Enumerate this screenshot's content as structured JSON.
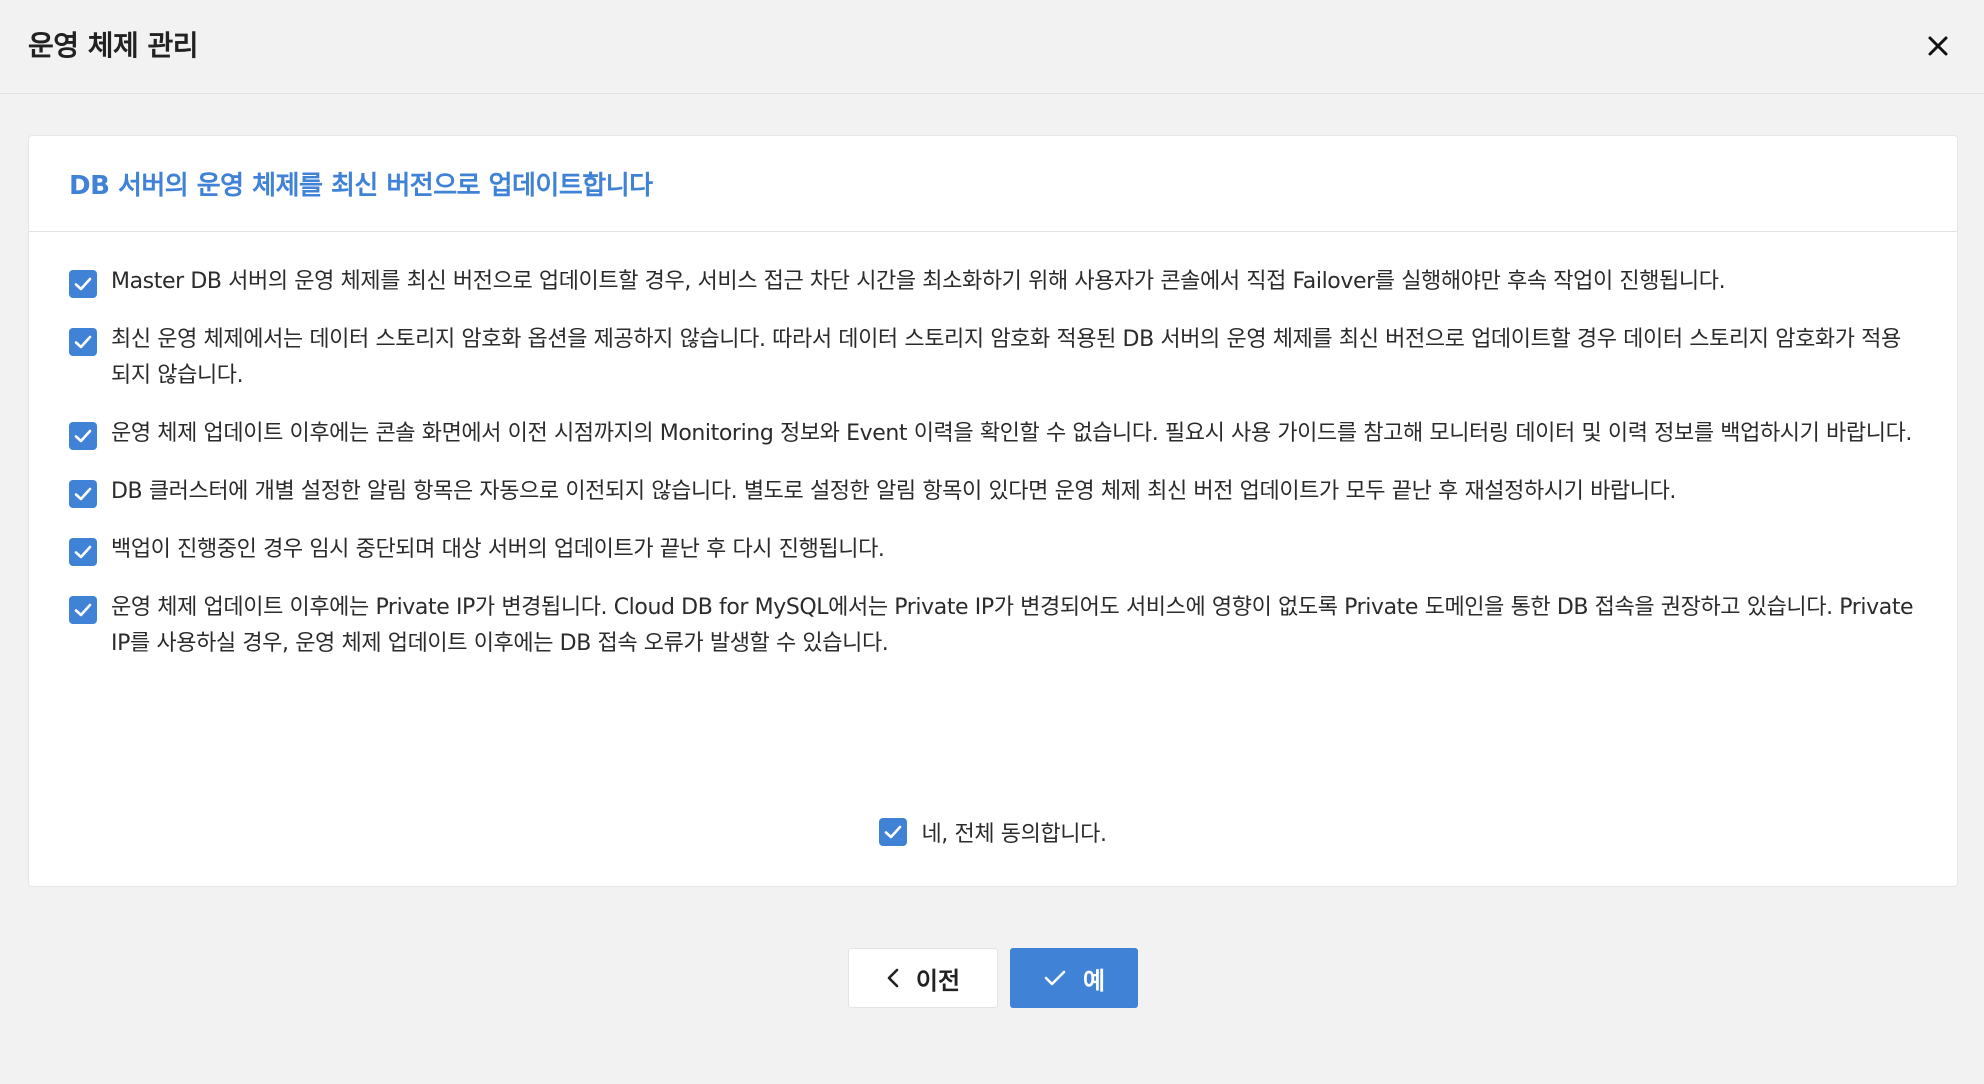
{
  "dialog": {
    "title": "운영 체제 관리",
    "close_icon": "close-icon"
  },
  "panel": {
    "subtitle": "DB 서버의 운영 체제를 최신 버전으로 업데이트합니다",
    "items": [
      {
        "checked": true,
        "text": "Master DB 서버의 운영 체제를 최신 버전으로 업데이트할 경우, 서비스 접근 차단 시간을 최소화하기 위해 사용자가 콘솔에서 직접 Failover를 실행해야만 후속 작업이 진행됩니다."
      },
      {
        "checked": true,
        "text": "최신 운영 체제에서는 데이터 스토리지 암호화 옵션을 제공하지 않습니다. 따라서 데이터 스토리지 암호화 적용된 DB 서버의 운영 체제를 최신 버전으로 업데이트할 경우 데이터 스토리지 암호화가 적용되지 않습니다."
      },
      {
        "checked": true,
        "text": "운영 체제 업데이트 이후에는 콘솔 화면에서 이전 시점까지의 Monitoring 정보와 Event 이력을 확인할 수 없습니다. 필요시 사용 가이드를 참고해 모니터링 데이터 및 이력 정보를 백업하시기 바랍니다."
      },
      {
        "checked": true,
        "text": "DB 클러스터에 개별 설정한 알림 항목은 자동으로 이전되지 않습니다. 별도로 설정한 알림 항목이 있다면 운영 체제 최신 버전 업데이트가 모두 끝난 후 재설정하시기 바랍니다."
      },
      {
        "checked": true,
        "text": "백업이 진행중인 경우 임시 중단되며 대상 서버의 업데이트가 끝난 후 다시 진행됩니다."
      },
      {
        "checked": true,
        "text": "운영 체제 업데이트 이후에는 Private IP가 변경됩니다. Cloud DB for MySQL에서는 Private IP가 변경되어도 서비스에 영향이 없도록 Private 도메인을 통한 DB 접속을 권장하고 있습니다. Private IP를 사용하실 경우, 운영 체제 업데이트 이후에는 DB 접속 오류가 발생할 수 있습니다."
      }
    ],
    "agree_all": {
      "checked": true,
      "label": "네, 전체 동의합니다."
    }
  },
  "buttons": {
    "prev": {
      "label": "이전",
      "icon": "chevron-left-icon"
    },
    "yes": {
      "label": "예",
      "icon": "check-icon"
    }
  },
  "colors": {
    "accent": "#3f82d6",
    "background": "#f2f2f2",
    "panel": "#ffffff"
  }
}
